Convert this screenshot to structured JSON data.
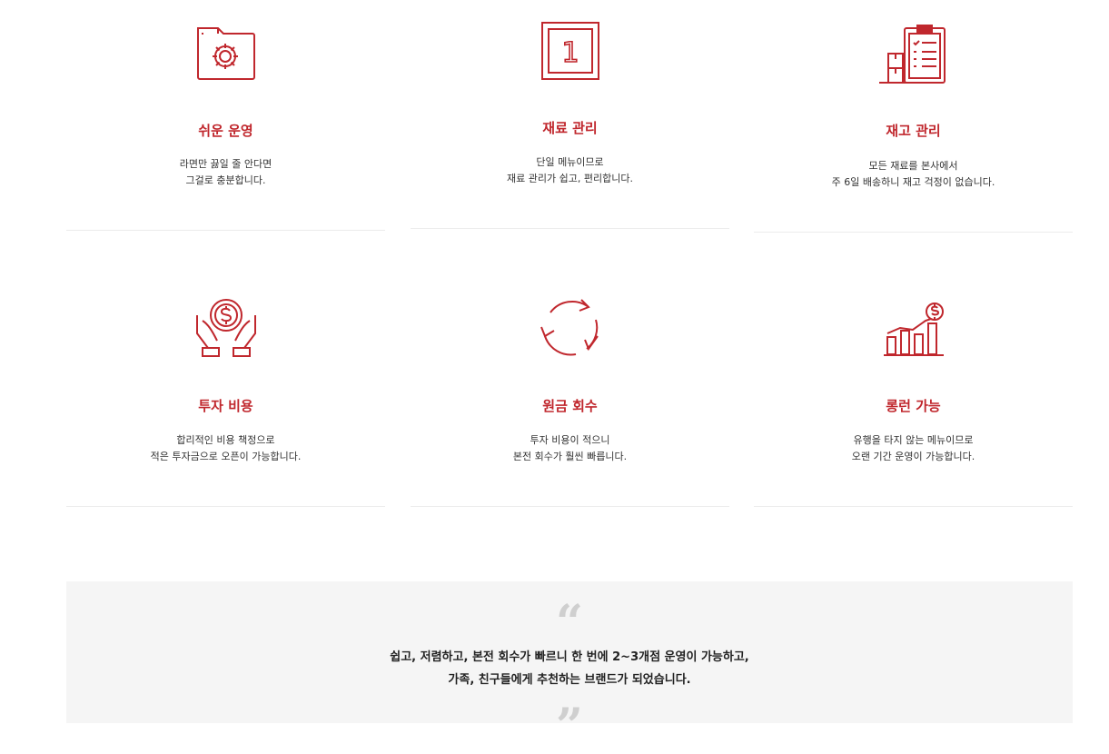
{
  "theme": {
    "accent": "#c0272d",
    "divider": "#ececec",
    "quote_bg": "#f5f5f5"
  },
  "features": [
    {
      "icon": "folder-gear-icon",
      "title": "쉬운 운영",
      "line1": "라면만 끓일 줄 안다면",
      "line2": "그걸로 충분합니다."
    },
    {
      "icon": "number-one-frame-icon",
      "title": "재료 관리",
      "line1": "단일 메뉴이므로",
      "line2": "재료 관리가 쉽고, 편리합니다.",
      "badge": "1"
    },
    {
      "icon": "clipboard-boxes-icon",
      "title": "재고 관리",
      "line1": "모든 재료를 본사에서",
      "line2": "주 6일 배송하니 재고 걱정이 없습니다."
    },
    {
      "icon": "hands-coin-icon",
      "title": "투자 비용",
      "line1": "합리적인 비용 책정으로",
      "line2": "적은 투자금으로 오픈이 가능합니다."
    },
    {
      "icon": "refresh-cycle-icon",
      "title": "원금 회수",
      "line1": "투자 비용이 적으니",
      "line2": "본전 회수가 훨씬 빠릅니다."
    },
    {
      "icon": "growth-chart-icon",
      "title": "롱런 가능",
      "line1": "유행을 타지 않는 메뉴이므로",
      "line2": "오랜 기간 운영이 가능합니다."
    }
  ],
  "testimonial": {
    "open_quote": "“",
    "close_quote": "”",
    "line1": "쉽고, 저렴하고, 본전 회수가 빠르니 한 번에 2~3개점 운영이 가능하고,",
    "line2": "가족, 친구들에게 추천하는 브랜드가 되었습니다."
  }
}
